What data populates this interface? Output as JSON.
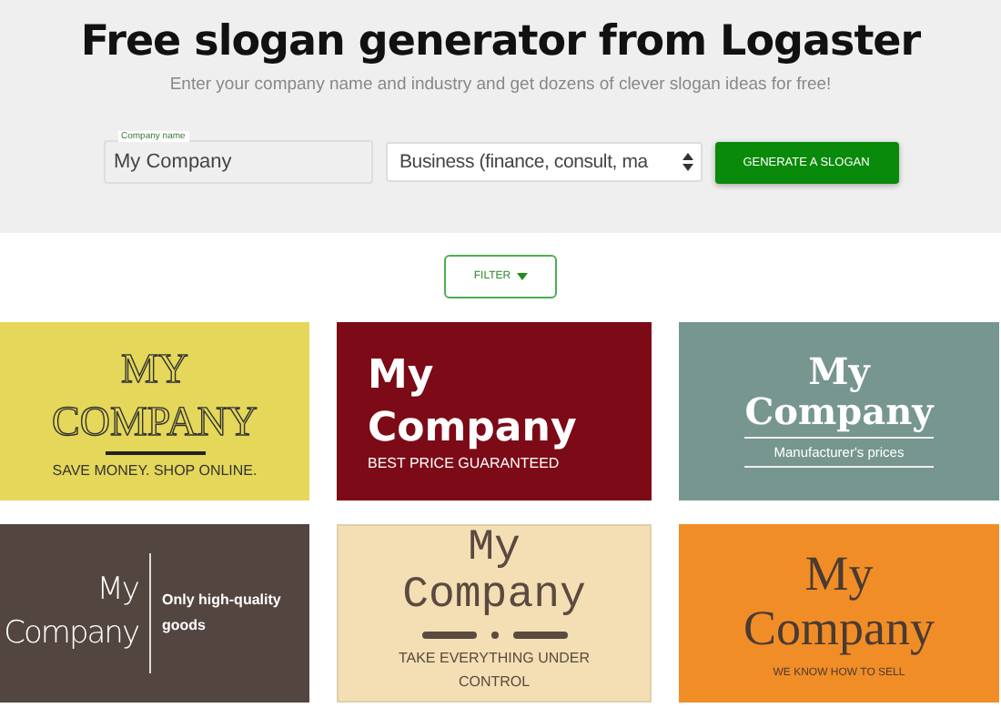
{
  "header": {
    "title": "Free slogan generator from Logaster",
    "subtitle": "Enter your company name and industry and get dozens of clever slogan ideas for free!"
  },
  "form": {
    "name_label": "Company name",
    "name_value": "My Company",
    "industry_value": "Business (finance, consult, ma",
    "button": "GENERATE A SLOGAN"
  },
  "filter": {
    "label": "FILTER"
  },
  "cards": [
    {
      "kind": "outline",
      "color": "#e4d75a",
      "name_lines": [
        "MY",
        "COMPANY"
      ],
      "slogan": "SAVE MONEY. SHOP ONLINE."
    },
    {
      "kind": "left",
      "color": "#7c0b17",
      "name_lines": [
        "My",
        "Company"
      ],
      "slogan": "BEST PRICE GUARANTEED"
    },
    {
      "kind": "lines",
      "color": "#76968f",
      "name_lines": [
        "My",
        "Company"
      ],
      "slogan": "Manufacturer's prices"
    },
    {
      "kind": "split",
      "color": "#534540",
      "name_lines": [
        "My",
        "Company"
      ],
      "slogan": "Only high-quality goods"
    },
    {
      "kind": "ornament",
      "color": "#f3dfb3",
      "name_lines": [
        "My",
        "Company"
      ],
      "slogan": "TAKE EVERYTHING UNDER CONTROL"
    },
    {
      "kind": "plain",
      "color": "#f18d27",
      "name_lines": [
        "My",
        "Company"
      ],
      "slogan": "WE KNOW HOW TO SELL"
    }
  ]
}
